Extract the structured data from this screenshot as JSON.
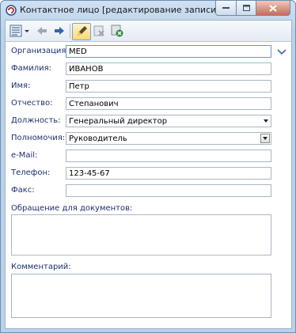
{
  "window": {
    "title": "Контактное лицо [редактирование записи]",
    "accent": "#1d2f6e"
  },
  "toolbar": {
    "items": [
      {
        "icon": "list-menu-icon"
      },
      {
        "icon": "back-arrow-icon"
      },
      {
        "icon": "forward-arrow-icon"
      },
      {
        "icon": "edit-pencil-icon",
        "active": true
      },
      {
        "icon": "delete-icon"
      },
      {
        "icon": "save-close-icon"
      }
    ]
  },
  "form": {
    "organization": {
      "label": "Организация:",
      "value": "MED"
    },
    "last_name": {
      "label": "Фамилия:",
      "value": "ИВАНОВ"
    },
    "first_name": {
      "label": "Имя:",
      "value": "Петр"
    },
    "patronymic": {
      "label": "Отчество:",
      "value": "Степанович"
    },
    "position": {
      "label": "Должность:",
      "value": "Генеральный директор"
    },
    "authority": {
      "label": "Полномочия:",
      "value": "Руководитель"
    },
    "email": {
      "label": "e-Mail:",
      "value": ""
    },
    "phone": {
      "label": "Телефон:",
      "value": "123-45-67"
    },
    "fax": {
      "label": "Факс:",
      "value": ""
    },
    "salutation": {
      "label": "Обращение для документов:",
      "value": ""
    },
    "comment": {
      "label": "Комментарий:",
      "value": ""
    }
  }
}
